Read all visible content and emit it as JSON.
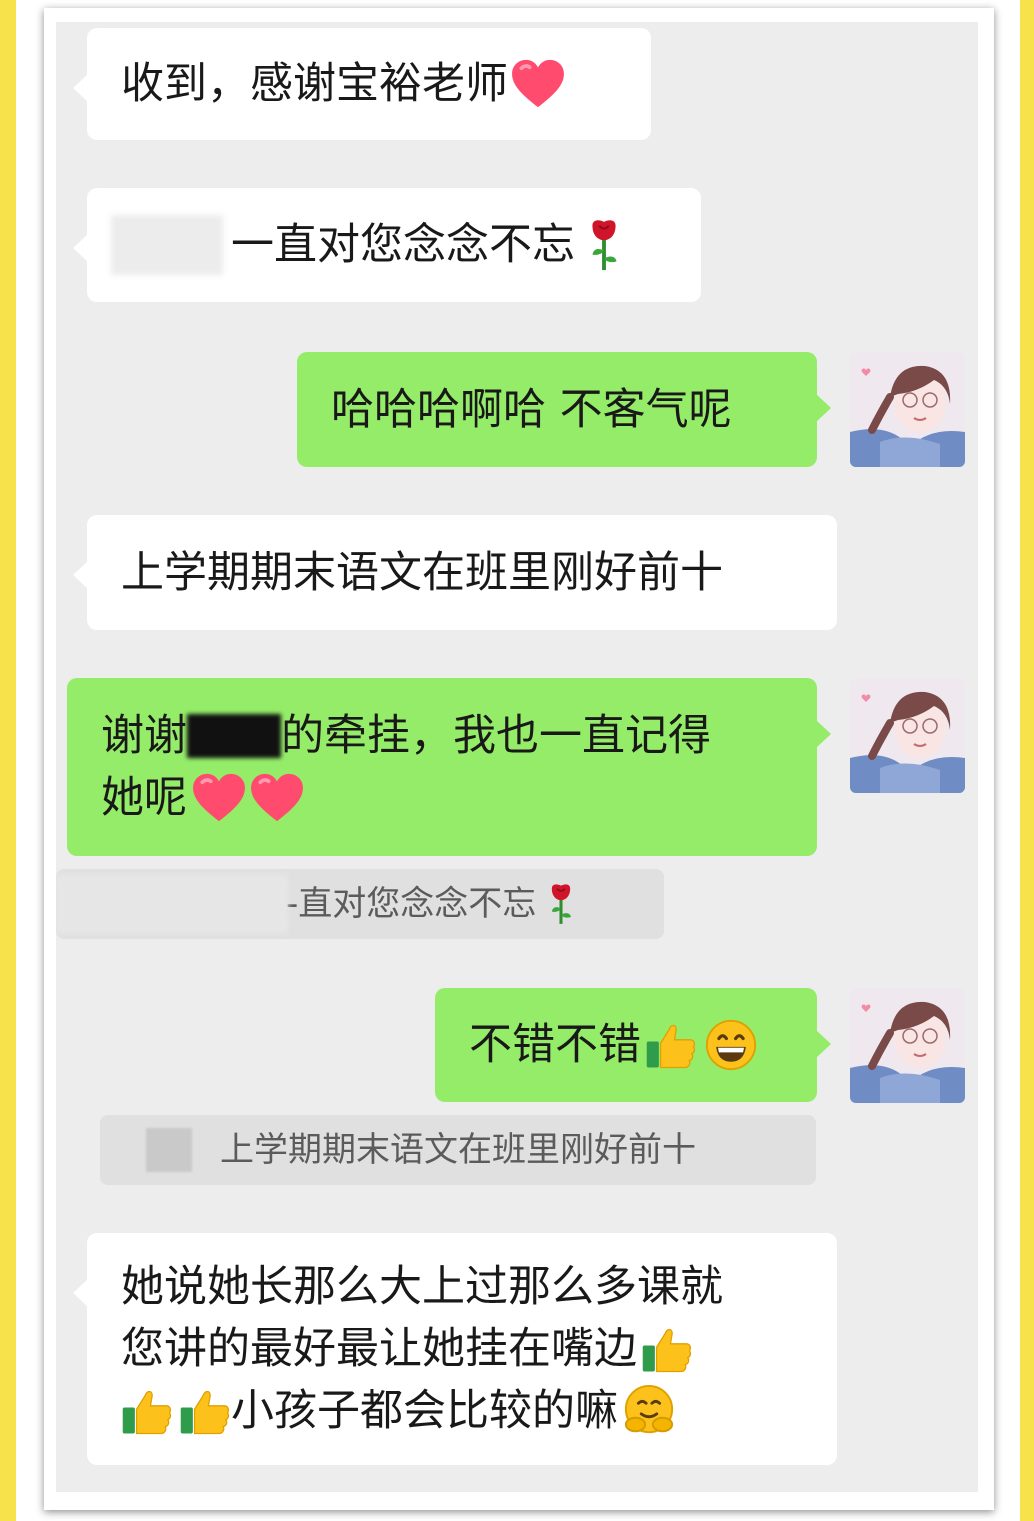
{
  "messages": {
    "m1": {
      "text": "收到，感谢宝裕老师",
      "emoji": "heart-icon"
    },
    "m2": {
      "text": "一直对您念念不忘",
      "emoji": "rose-icon"
    },
    "m3": {
      "text": "哈哈哈啊哈 不客气呢"
    },
    "m4": {
      "text": "上学期期末语文在班里刚好前十"
    },
    "m5": {
      "line1_a": "谢谢",
      "line1_b": "的牵挂，我也一直记得",
      "line2": "她呢",
      "emoji": "heart-icon"
    },
    "m5_quote": {
      "text": "-直对您念念不忘"
    },
    "m6": {
      "text": "不错不错",
      "emoji1": "thumbs-up-icon",
      "emoji2": "grinning-face-icon"
    },
    "m6_quote": {
      "text": "上学期期末语文在班里刚好前十"
    },
    "m7": {
      "line1": "她说她长那么大上过那么多课就",
      "line2": "您讲的最好最让她挂在嘴边",
      "line3": "小孩子都会比较的嘛"
    }
  },
  "colors": {
    "frame": "#f7e24c",
    "chat_background": "#ededed",
    "incoming_bubble": "#ffffff",
    "outgoing_bubble": "#95ec69",
    "quote_background": "#e0e0e0"
  }
}
